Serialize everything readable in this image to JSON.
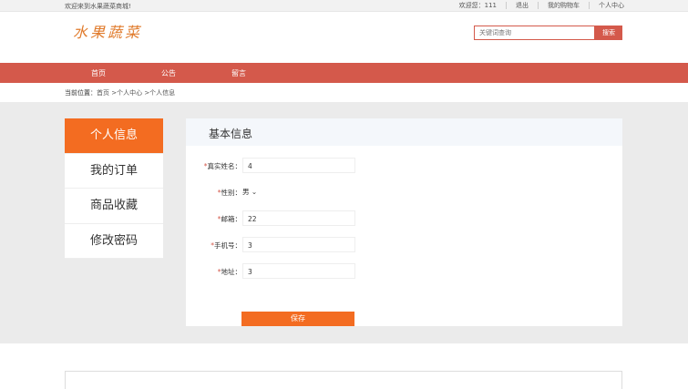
{
  "topbar": {
    "welcome": "欢迎来到水果蔬菜商城!",
    "user": "欢迎您：111",
    "logout": "退出",
    "cart": "我的购物车",
    "personal": "个人中心"
  },
  "header": {
    "logo": "水果蔬菜",
    "search_placeholder": "关键词查询",
    "search_button": "搜索"
  },
  "nav": {
    "items": [
      "首页",
      "公告",
      "留言"
    ]
  },
  "breadcrumb": {
    "label": "当前位置：",
    "path": "首页 >个人中心 >个人信息"
  },
  "side_menu": {
    "items": [
      "个人信息",
      "我的订单",
      "商品收藏",
      "修改密码"
    ],
    "active": "个人信息"
  },
  "panel": {
    "title": "基本信息",
    "fields": [
      {
        "label": "真实姓名：",
        "value": "4",
        "required": true
      },
      {
        "label": "性别：",
        "value": "男",
        "required": true
      },
      {
        "label": "邮箱：",
        "value": "22",
        "required": true
      },
      {
        "label": "手机号：",
        "value": "3",
        "required": true
      },
      {
        "label": "地址：",
        "value": "3",
        "required": true
      }
    ],
    "required_mark": "*",
    "dropdown_icon": "chevron-down-icon",
    "save_button": "保存"
  },
  "colors": {
    "nav": "#d4594b",
    "accent": "#f36c21",
    "logo": "#e07b2c"
  }
}
